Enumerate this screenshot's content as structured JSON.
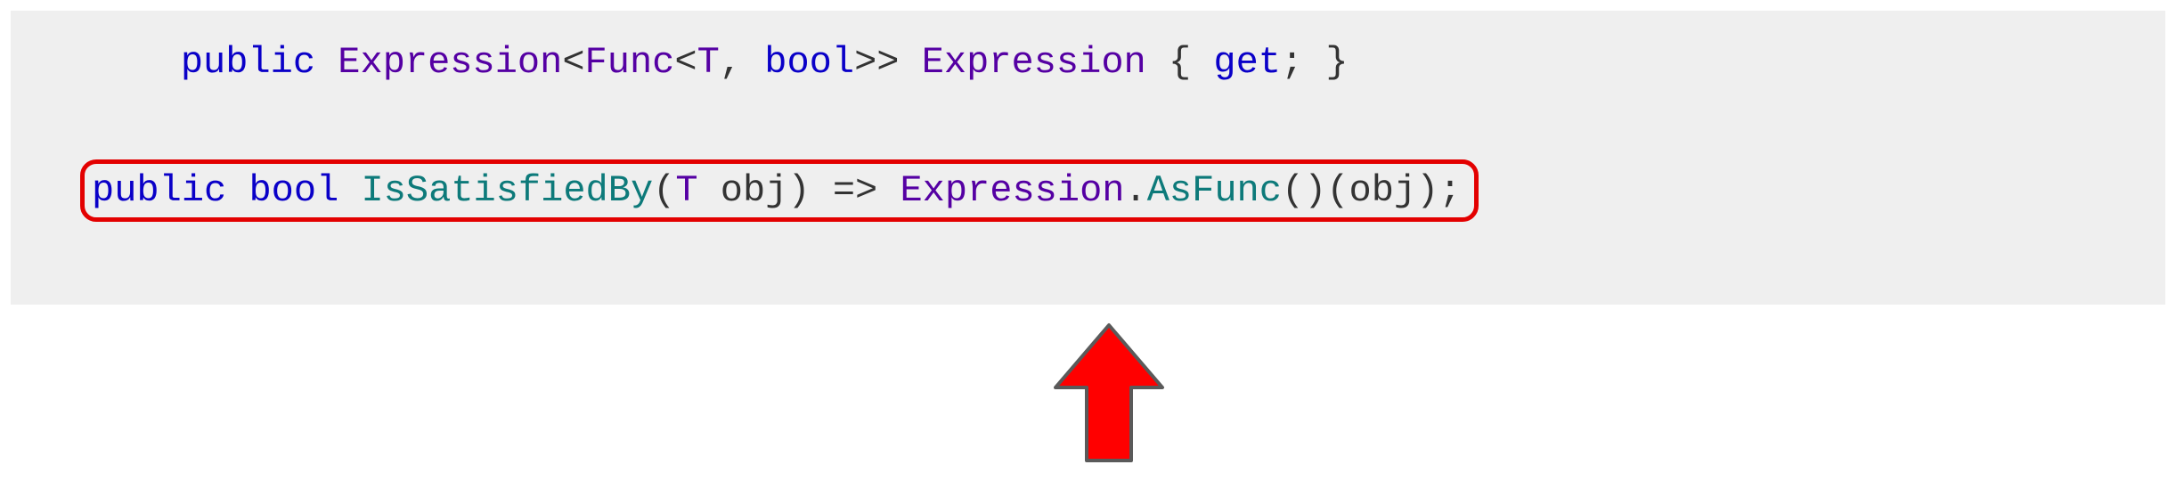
{
  "code": {
    "line1": {
      "tok1": "public",
      "tok2": " ",
      "tok3": "Expression",
      "tok4": "<",
      "tok5": "Func",
      "tok6": "<",
      "tok7": "T",
      "tok8": ", ",
      "tok9": "bool",
      "tok10": ">> ",
      "tok11": "Expression",
      "tok12": " { ",
      "tok13": "get",
      "tok14": "; }"
    },
    "line2": {
      "tok1": "public",
      "tok2": " ",
      "tok3": "bool",
      "tok4": " ",
      "tok5": "IsSatisfiedBy",
      "tok6": "(",
      "tok7": "T",
      "tok8": " obj) => ",
      "tok9": "Expression",
      "tok10": ".",
      "tok11": "AsFunc",
      "tok12": "()(obj);"
    }
  }
}
